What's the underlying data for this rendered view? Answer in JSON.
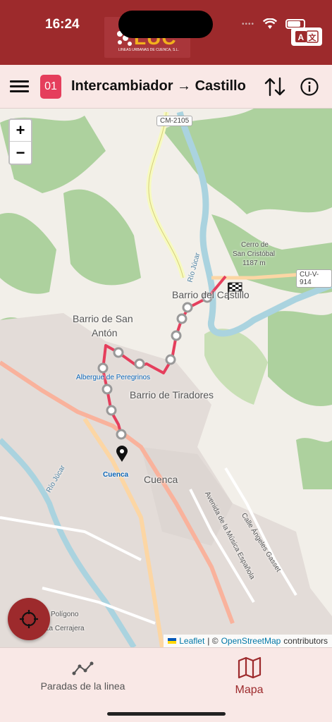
{
  "status_bar": {
    "time": "16:24",
    "wifi_icon": "wifi-icon",
    "battery_icon": "battery-icon",
    "translate_icon": "translate-icon"
  },
  "brand": {
    "logo_text": "LUC",
    "logo_subtitle": "LINEAS URBANAS DE CUENCA, S.L."
  },
  "toolbar": {
    "menu_icon": "hamburger-menu-icon",
    "line_number": "01",
    "line_color": "#e53e5c",
    "route_title": "Intercambiador → Castillo",
    "swap_icon": "swap-direction-icon",
    "info_icon": "info-icon"
  },
  "map": {
    "zoom_in": "+",
    "zoom_out": "−",
    "labels": {
      "cm2105": "CM-2105",
      "cuv914": "CU-V-914",
      "cerro": "Cerro de",
      "cerro2": "San Cristóbal",
      "elev": "1187 m",
      "castillo": "Barrio del Castillo",
      "san_anton": "Barrio de San",
      "san_anton2": "Antón",
      "albergue": "Albergue de Peregrinos",
      "tiradores": "Barrio de Tiradores",
      "cuenca_big": "Cuenca",
      "cuenca_station": "Cuenca",
      "rio_jucar_n": "Río Júcar",
      "rio_jucar_w": "Río Júcar",
      "avenida": "Avenida de la Música Española",
      "calle": "Calle Ángeles Gasset",
      "poligono": "Polígono",
      "cerrajera": "La Cerrajera"
    },
    "route_color": "#e53e5c",
    "locate_icon": "crosshair-locate-icon",
    "attribution": {
      "leaflet": "Leaflet",
      "sep": "| ©",
      "osm": "OpenStreetMap",
      "contrib": "contributors"
    }
  },
  "bottom_nav": {
    "tabs": [
      {
        "label": "Paradas de la linea",
        "icon": "route-stops-icon"
      },
      {
        "label": "Mapa",
        "icon": "map-icon"
      }
    ],
    "accent": "#9d2a2c"
  }
}
